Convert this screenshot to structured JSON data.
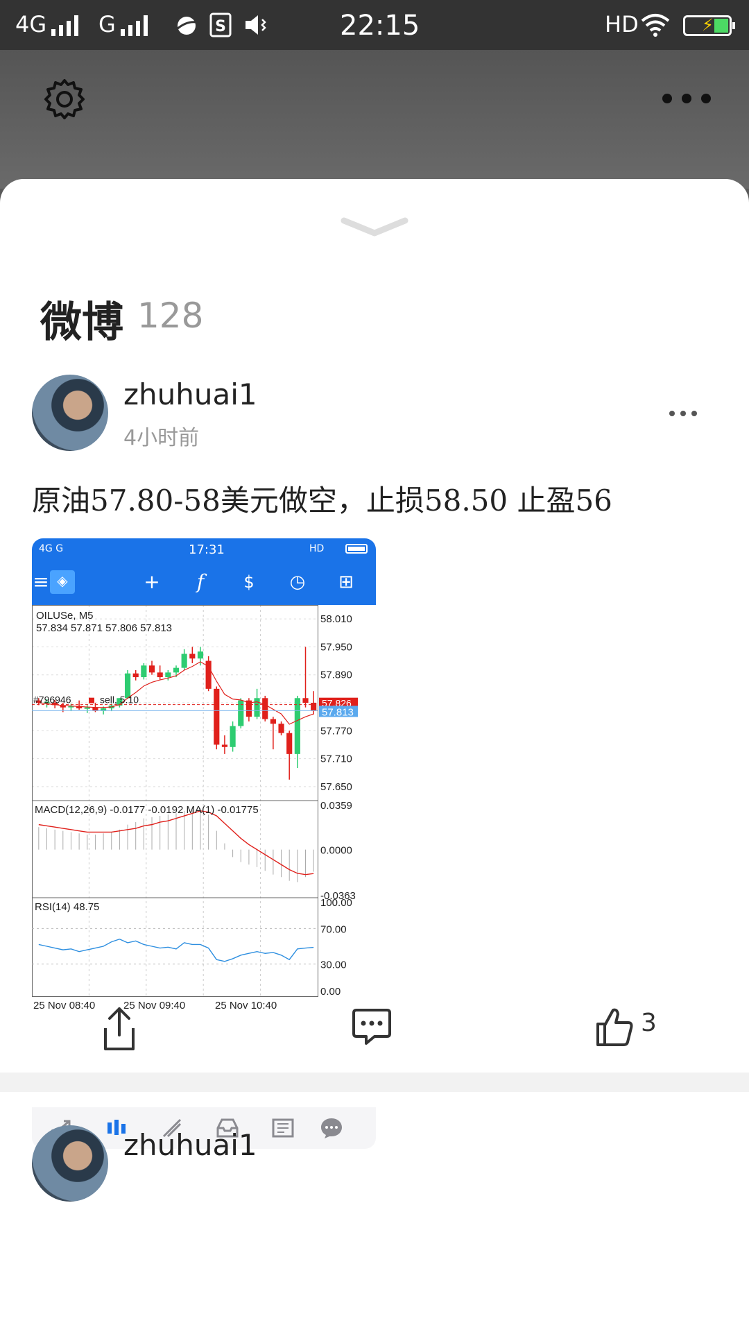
{
  "status_bar": {
    "network_1": "4G",
    "network_2": "G",
    "time": "22:15",
    "hd": "HD"
  },
  "section": {
    "title": "微博",
    "count": "128"
  },
  "post": {
    "username": "zhuhuai1",
    "time_ago": "4小时前",
    "text": "原油57.80-58美元做空，止损58.50 止盈56",
    "like_count": "3"
  },
  "next_post": {
    "username": "zhuhuai1"
  },
  "embedded_screenshot": {
    "status_time": "17:31",
    "status_left": "4G G",
    "status_right": "HD",
    "symbol": "OILUSe, M5",
    "ohlc": "57.834 57.871 57.806 57.813",
    "order_label": "#796946",
    "order_type": "sell, 5.10",
    "bid_label": "57.826",
    "ask_label": "57.813",
    "price_ticks": [
      "58.010",
      "57.950",
      "57.890",
      "57.770",
      "57.710",
      "57.650"
    ],
    "macd_label": "MACD(12,26,9) -0.0177 -0.0192 MA(1) -0.01775",
    "macd_ticks": [
      "0.0359",
      "0.0000",
      "-0.0363"
    ],
    "rsi_label": "RSI(14) 48.75",
    "rsi_ticks": [
      "100.00",
      "70.00",
      "30.00",
      "0.00"
    ],
    "time_ticks": [
      "25 Nov 08:40",
      "25 Nov 09:40",
      "25 Nov 10:40"
    ],
    "colors": {
      "bull": "#2ecc71",
      "bear": "#e0201b",
      "header": "#1a73e8",
      "rsi": "#2e8fe0"
    },
    "candles": [
      [
        57.835,
        57.84,
        57.825,
        57.83
      ],
      [
        57.83,
        57.838,
        57.82,
        57.832
      ],
      [
        57.83,
        57.836,
        57.818,
        57.825
      ],
      [
        57.825,
        57.83,
        57.81,
        57.82
      ],
      [
        57.82,
        57.828,
        57.812,
        57.823
      ],
      [
        57.823,
        57.835,
        57.815,
        57.818
      ],
      [
        57.818,
        57.825,
        57.808,
        57.82
      ],
      [
        57.82,
        57.83,
        57.81,
        57.813
      ],
      [
        57.813,
        57.822,
        57.805,
        57.818
      ],
      [
        57.818,
        57.828,
        57.812,
        57.824
      ],
      [
        57.824,
        57.84,
        57.82,
        57.84
      ],
      [
        57.84,
        57.9,
        57.838,
        57.893
      ],
      [
        57.893,
        57.9,
        57.878,
        57.885
      ],
      [
        57.885,
        57.915,
        57.88,
        57.91
      ],
      [
        57.91,
        57.92,
        57.89,
        57.895
      ],
      [
        57.895,
        57.91,
        57.88,
        57.885
      ],
      [
        57.885,
        57.9,
        57.878,
        57.895
      ],
      [
        57.895,
        57.91,
        57.885,
        57.905
      ],
      [
        57.905,
        57.945,
        57.9,
        57.935
      ],
      [
        57.935,
        57.95,
        57.915,
        57.925
      ],
      [
        57.925,
        57.95,
        57.91,
        57.94
      ],
      [
        57.92,
        57.93,
        57.855,
        57.86
      ],
      [
        57.86,
        57.865,
        57.73,
        57.74
      ],
      [
        57.74,
        57.76,
        57.72,
        57.735
      ],
      [
        57.735,
        57.79,
        57.725,
        57.78
      ],
      [
        57.78,
        57.84,
        57.775,
        57.835
      ],
      [
        57.835,
        57.84,
        57.79,
        57.8
      ],
      [
        57.8,
        57.86,
        57.795,
        57.84
      ],
      [
        57.84,
        57.845,
        57.79,
        57.795
      ],
      [
        57.795,
        57.8,
        57.73,
        57.785
      ],
      [
        57.785,
        57.79,
        57.76,
        57.765
      ],
      [
        57.765,
        57.77,
        57.665,
        57.72
      ],
      [
        57.72,
        57.845,
        57.69,
        57.84
      ],
      [
        57.84,
        57.95,
        57.82,
        57.83
      ],
      [
        57.83,
        57.855,
        57.805,
        57.813
      ]
    ],
    "ma_line": [
      57.83,
      57.828,
      57.826,
      57.824,
      57.823,
      57.822,
      57.821,
      57.82,
      57.82,
      57.821,
      57.826,
      57.84,
      57.852,
      57.866,
      57.874,
      57.879,
      57.883,
      57.888,
      57.9,
      57.908,
      57.918,
      57.908,
      57.876,
      57.848,
      57.838,
      57.836,
      57.83,
      57.832,
      57.826,
      57.816,
      57.806,
      57.784,
      57.792,
      57.8,
      57.806
    ],
    "macd_hist": [
      0.018,
      0.017,
      0.016,
      0.015,
      0.014,
      0.013,
      0.012,
      0.012,
      0.013,
      0.014,
      0.016,
      0.02,
      0.022,
      0.025,
      0.026,
      0.027,
      0.028,
      0.029,
      0.031,
      0.032,
      0.033,
      0.028,
      0.015,
      0.005,
      -0.006,
      -0.01,
      -0.012,
      -0.014,
      -0.017,
      -0.02,
      -0.022,
      -0.025,
      -0.026,
      -0.022,
      -0.0177
    ],
    "macd_signal": [
      0.02,
      0.019,
      0.018,
      0.017,
      0.016,
      0.015,
      0.014,
      0.014,
      0.014,
      0.014,
      0.015,
      0.016,
      0.017,
      0.019,
      0.02,
      0.022,
      0.023,
      0.025,
      0.027,
      0.029,
      0.031,
      0.03,
      0.027,
      0.021,
      0.015,
      0.009,
      0.004,
      0.0,
      -0.004,
      -0.008,
      -0.012,
      -0.016,
      -0.019,
      -0.02,
      -0.0192
    ],
    "rsi": [
      52,
      50,
      48,
      46,
      47,
      44,
      46,
      48,
      50,
      55,
      58,
      54,
      56,
      52,
      50,
      48,
      49,
      47,
      54,
      52,
      52,
      48,
      35,
      33,
      36,
      40,
      42,
      44,
      42,
      43,
      40,
      35,
      47,
      48,
      48.75
    ]
  }
}
